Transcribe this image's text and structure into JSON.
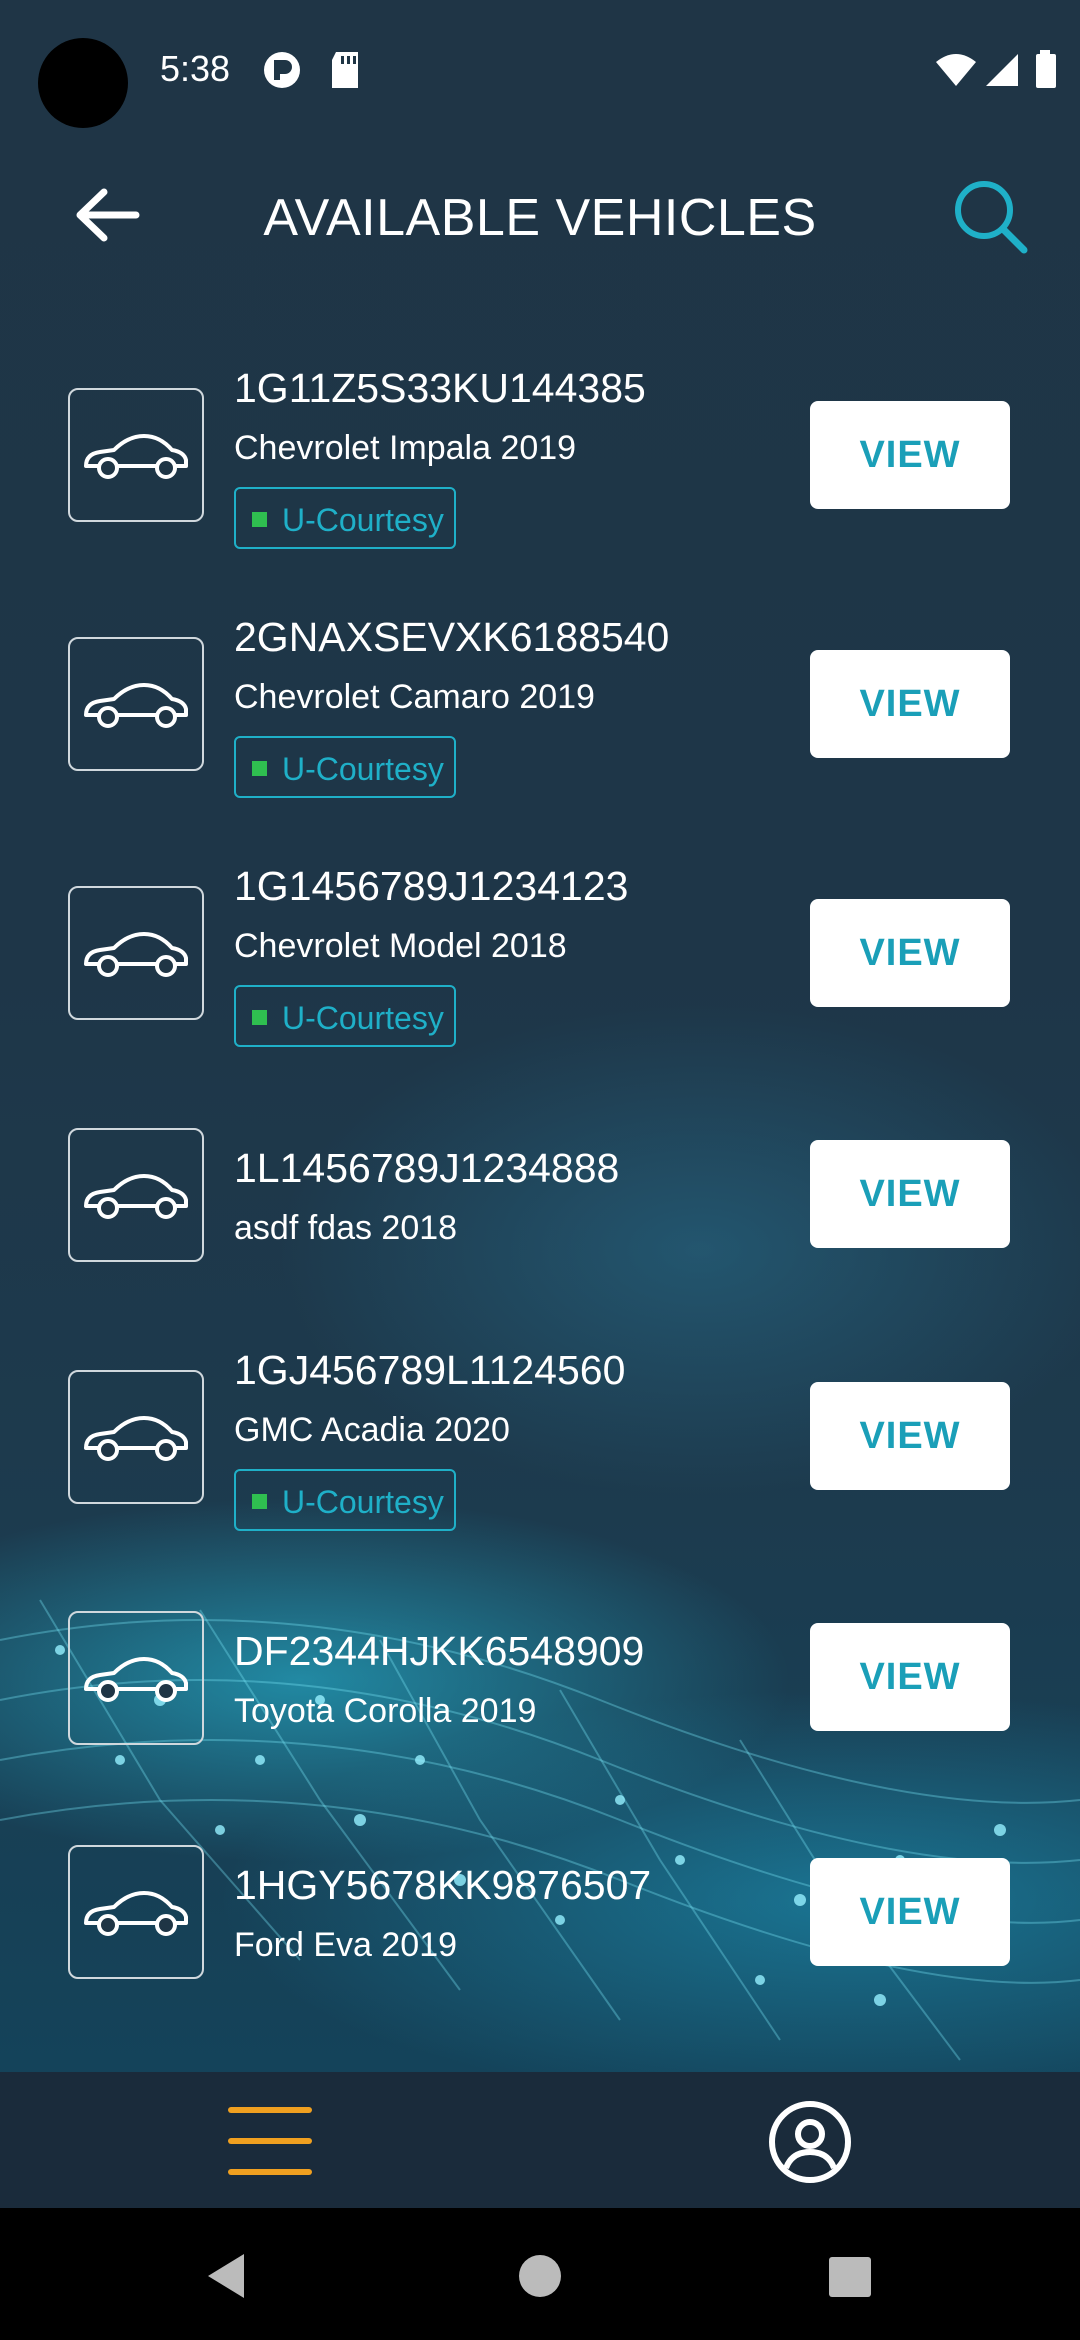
{
  "status_bar": {
    "time": "5:38"
  },
  "header": {
    "title": "AVAILABLE VEHICLES"
  },
  "vehicles": [
    {
      "vin": "1G11Z5S33KU144385",
      "model": "Chevrolet Impala 2019",
      "badge": "U-Courtesy",
      "button": "VIEW"
    },
    {
      "vin": "2GNAXSEVXK6188540",
      "model": "Chevrolet Camaro 2019",
      "badge": "U-Courtesy",
      "button": "VIEW"
    },
    {
      "vin": "1G1456789J1234123",
      "model": "Chevrolet Model 2018",
      "badge": "U-Courtesy",
      "button": "VIEW"
    },
    {
      "vin": "1L1456789J1234888",
      "model": "asdf fdas 2018",
      "badge": "",
      "button": "VIEW"
    },
    {
      "vin": "1GJ456789L1124560",
      "model": "GMC Acadia 2020",
      "badge": "U-Courtesy",
      "button": "VIEW"
    },
    {
      "vin": "DF2344HJKK6548909",
      "model": "Toyota Corolla 2019",
      "badge": "",
      "button": "VIEW"
    },
    {
      "vin": "1HGY5678KK9876507",
      "model": "Ford Eva 2019",
      "badge": "",
      "button": "VIEW"
    }
  ],
  "colors": {
    "accent": "#1fb0c8",
    "badge_dot": "#2fbf50",
    "menu_icon": "#f0a020"
  },
  "icons": [
    "back-arrow-icon",
    "search-icon",
    "car-icon",
    "menu-icon",
    "profile-icon"
  ]
}
